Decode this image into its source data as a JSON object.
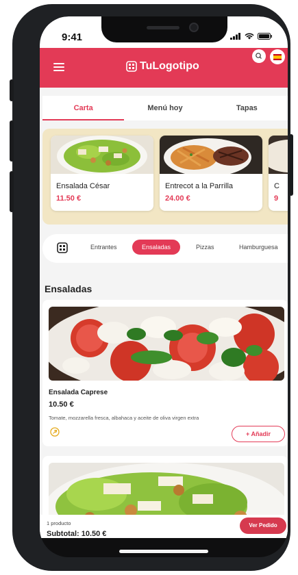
{
  "status": {
    "time": "9:41"
  },
  "header": {
    "brand": "TuLogotipo",
    "accent": "#e33a56"
  },
  "tabs": [
    {
      "label": "Carta",
      "active": true
    },
    {
      "label": "Menú hoy",
      "active": false
    },
    {
      "label": "Tapas",
      "active": false
    }
  ],
  "featured": [
    {
      "name": "Ensalada César",
      "price": "11.50 €"
    },
    {
      "name": "Entrecot a la Parrilla",
      "price": "24.00 €"
    },
    {
      "name": "C",
      "price": "9"
    }
  ],
  "categories": [
    {
      "label": "Entrantes",
      "active": false
    },
    {
      "label": "Ensaladas",
      "active": true
    },
    {
      "label": "Pizzas",
      "active": false
    },
    {
      "label": "Hamburguesa",
      "active": false
    }
  ],
  "section": {
    "title": "Ensaladas"
  },
  "items": [
    {
      "name": "Ensalada Caprese",
      "price": "10.50 €",
      "description": "Tomate, mozzarella fresca, albahaca y aceite de oliva virgen extra",
      "add_label": "+ Añadir",
      "badge_icon": "vegetarian-icon"
    }
  ],
  "order": {
    "count": "1 producto",
    "subtotal": "Subtotal: 10.50 €",
    "button": "Ver Pedido"
  }
}
